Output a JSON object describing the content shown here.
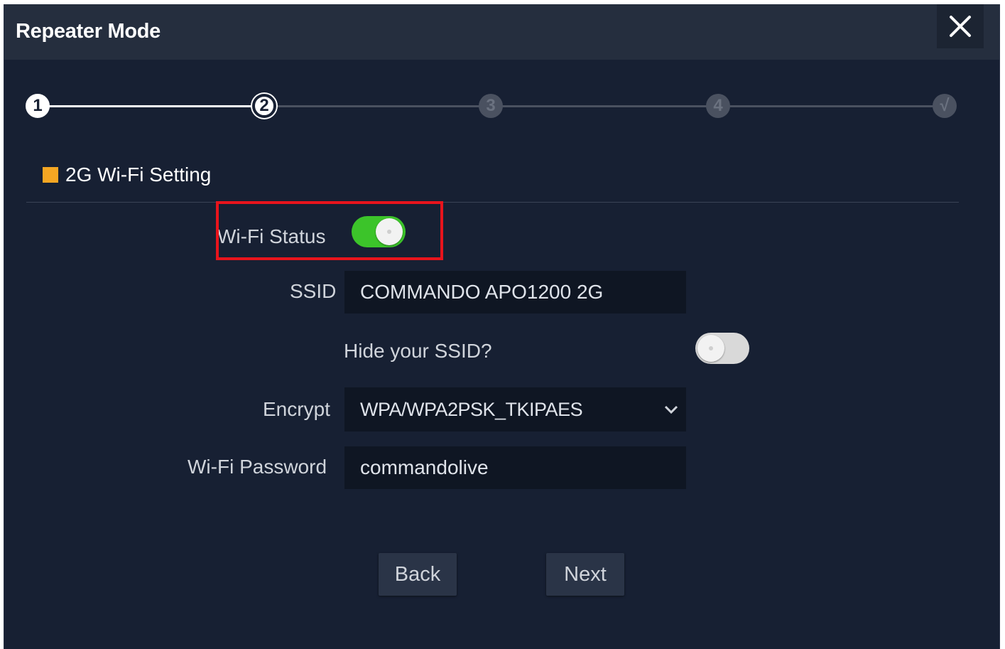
{
  "window": {
    "title": "Repeater Mode",
    "close_icon": "close-icon"
  },
  "stepper": {
    "steps": [
      {
        "label": "1",
        "state": "done"
      },
      {
        "label": "2",
        "state": "active"
      },
      {
        "label": "3",
        "state": "todo"
      },
      {
        "label": "4",
        "state": "todo"
      },
      {
        "label": "√",
        "state": "todo"
      }
    ]
  },
  "section": {
    "title": "2G Wi-Fi Setting",
    "accent_color": "#f5a623"
  },
  "form": {
    "wifi_status": {
      "label": "Wi-Fi Status",
      "enabled": true,
      "on_color": "#3cc42a"
    },
    "ssid": {
      "label": "SSID",
      "value": "COMMANDO APO1200 2G"
    },
    "hide_ssid": {
      "label": "Hide your SSID?",
      "enabled": false
    },
    "encrypt": {
      "label": "Encrypt",
      "value": "WPA/WPA2PSK_TKIPAES"
    },
    "password": {
      "label": "Wi-Fi Password",
      "value": "commandolive"
    }
  },
  "buttons": {
    "back": "Back",
    "next": "Next"
  },
  "highlight_color": "#e8141c"
}
